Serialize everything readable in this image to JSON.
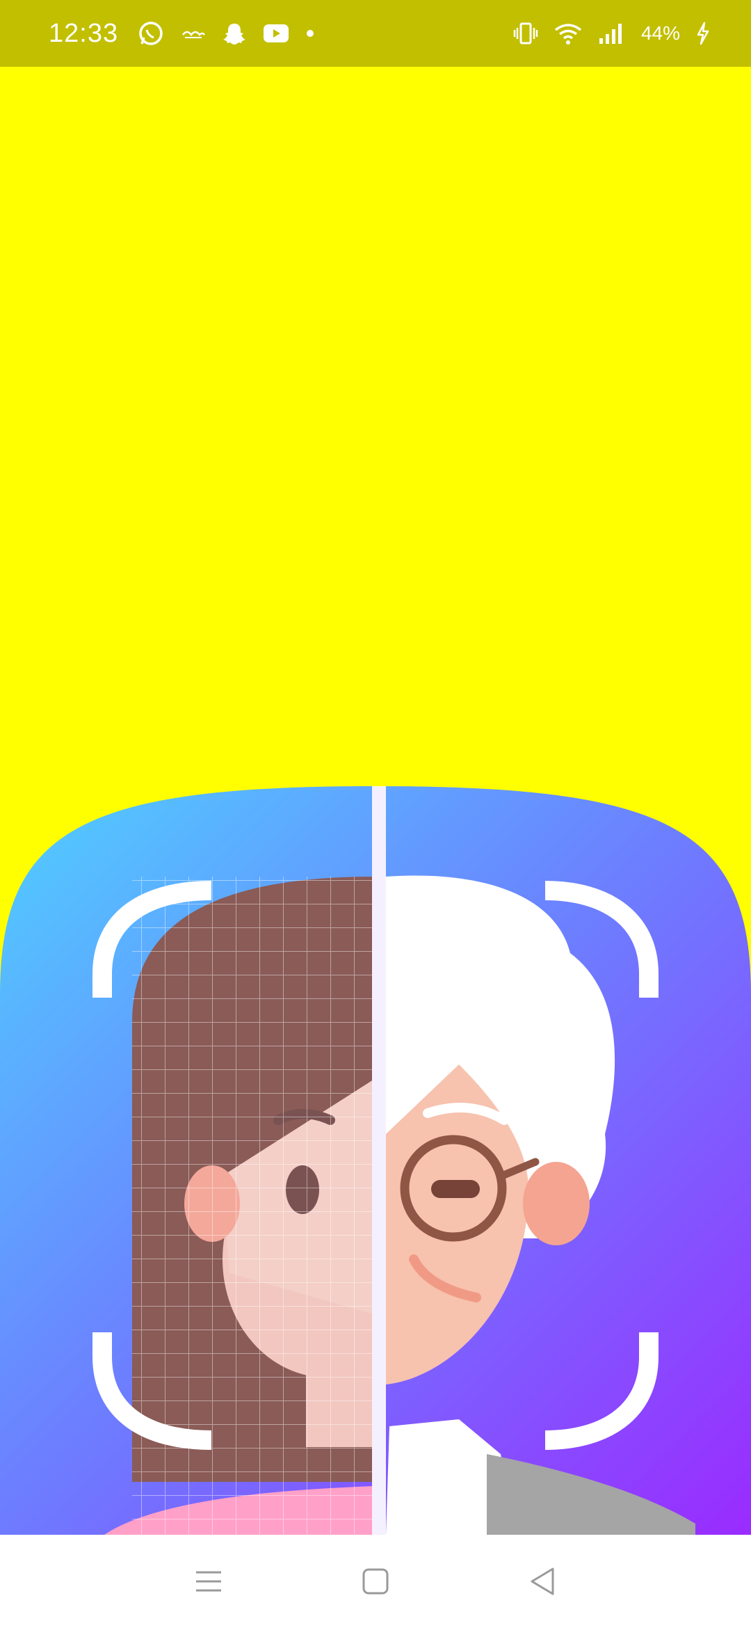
{
  "status_bar": {
    "time": "12:33",
    "battery_text": "44%",
    "left_icons": [
      "whatsapp-icon",
      "cloud-notification-icon",
      "snapchat-icon",
      "youtube-icon",
      "dot-icon"
    ],
    "right_icons": [
      "vibrate-icon",
      "wifi-icon",
      "signal-icon",
      "battery-charging-icon"
    ],
    "bg_color": "#C2BF00"
  },
  "splash": {
    "bg_color": "#FFFF00",
    "logo_icon": "face-aging-app-logo-icon"
  },
  "nav_bar": {
    "buttons": [
      "menu-icon",
      "home-icon",
      "back-icon"
    ]
  }
}
